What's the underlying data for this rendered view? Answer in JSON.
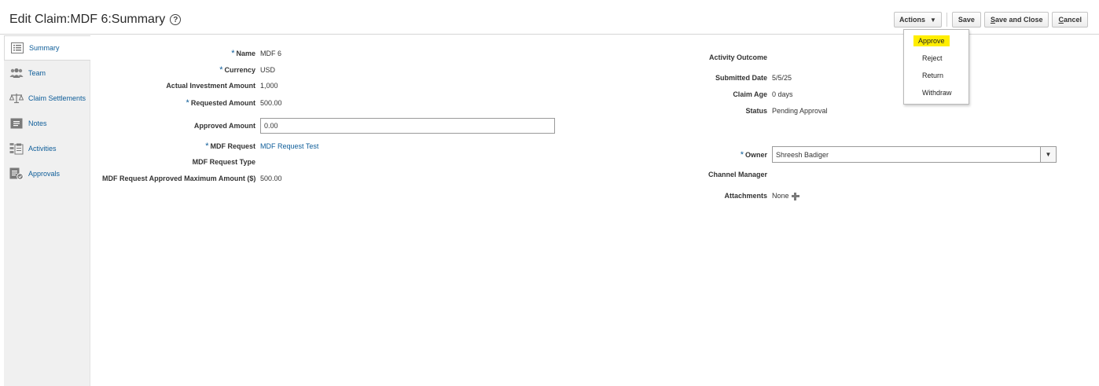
{
  "header": {
    "title": "Edit Claim:MDF 6:Summary",
    "help_glyph": "?"
  },
  "toolbar": {
    "actions_label": "Actions",
    "save_label": "Save",
    "save_close_first": "S",
    "save_close_rest": "ave and Close",
    "cancel_first": "C",
    "cancel_rest": "ancel"
  },
  "actions_menu": {
    "items": [
      "Approve",
      "Reject",
      "Return",
      "Withdraw"
    ],
    "highlight_color": "#ffee00"
  },
  "sidebar": {
    "items": [
      {
        "label": "Summary",
        "icon": "summary-icon"
      },
      {
        "label": "Team",
        "icon": "team-icon"
      },
      {
        "label": "Claim Settlements",
        "icon": "scales-icon"
      },
      {
        "label": "Notes",
        "icon": "notes-icon"
      },
      {
        "label": "Activities",
        "icon": "activities-icon"
      },
      {
        "label": "Approvals",
        "icon": "approvals-icon"
      }
    ]
  },
  "form": {
    "name_label": "Name",
    "name_value": "MDF 6",
    "currency_label": "Currency",
    "currency_value": "USD",
    "actual_investment_label": "Actual Investment Amount",
    "actual_investment_value": "1,000",
    "requested_label": "Requested Amount",
    "requested_value": "500.00",
    "approved_label": "Approved Amount",
    "approved_value": "0.00",
    "mdf_request_label": "MDF Request",
    "mdf_request_value": "MDF Request Test",
    "mdf_request_type_label": "MDF Request Type",
    "max_amount_label": "MDF Request Approved Maximum Amount ($)",
    "max_amount_value": "500.00",
    "required_mark": "*"
  },
  "details": {
    "activity_outcome_label": "Activity Outcome",
    "submitted_label": "Submitted Date",
    "submitted_value": "5/5/25",
    "claim_age_label": "Claim Age",
    "claim_age_value": "0 days",
    "status_label": "Status",
    "status_value": "Pending Approval",
    "owner_label": "Owner",
    "owner_value": "Shreesh Badiger",
    "channel_manager_label": "Channel Manager",
    "attachments_label": "Attachments",
    "attachments_value": "None"
  },
  "colors": {
    "link": "#0e5d99",
    "sidebar_bg": "#f0f0f0"
  }
}
